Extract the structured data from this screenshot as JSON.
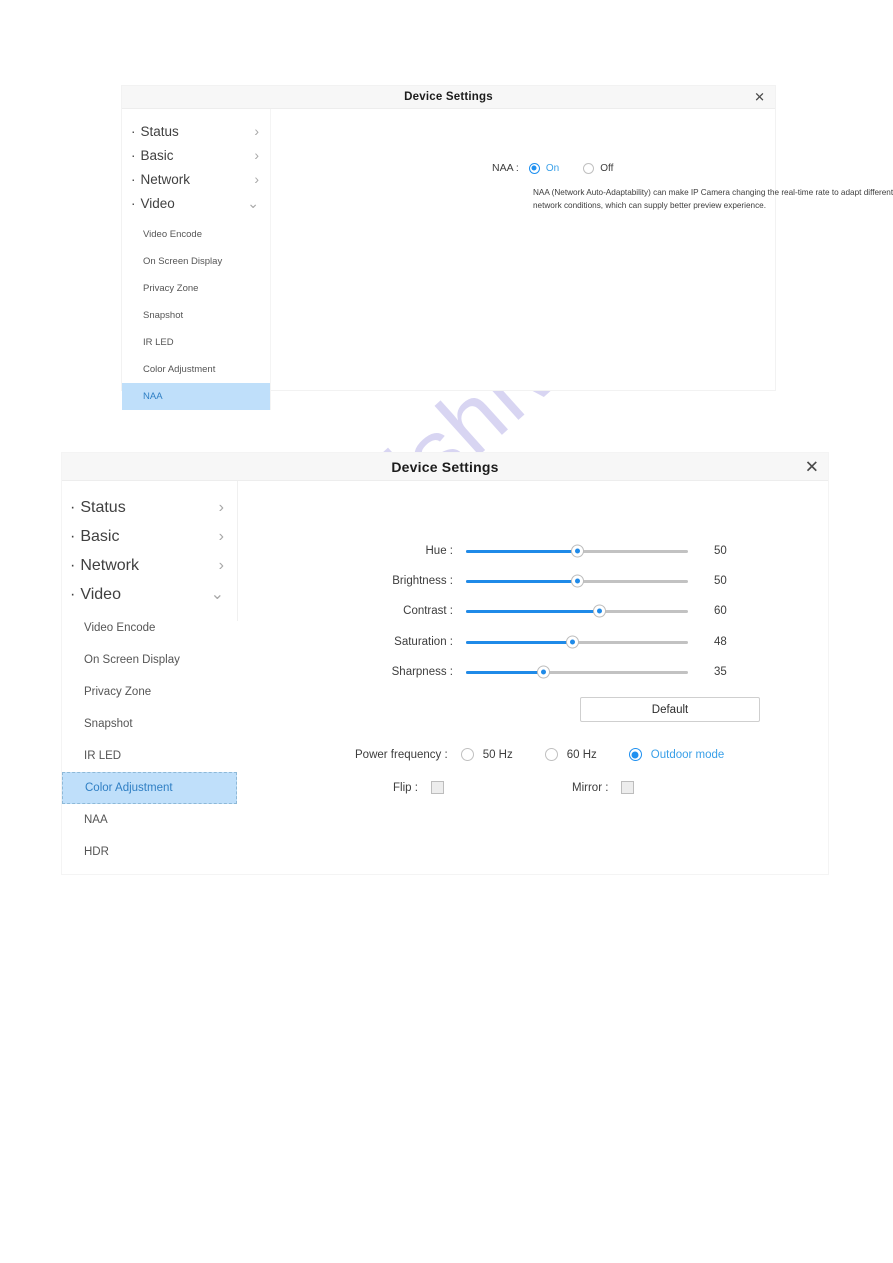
{
  "watermark": {
    "text": "manualshive.com",
    "color": "#b9b4e8"
  },
  "theme": {
    "accent": "#1f8ae8",
    "link": "#3aa0e8",
    "selection_bg": "#bfdffa"
  },
  "dialog_naa": {
    "title": "Device Settings",
    "close_glyph": "✕",
    "sidebar": {
      "top_items": [
        {
          "label": "Status",
          "chevron": "right"
        },
        {
          "label": "Basic",
          "chevron": "right"
        },
        {
          "label": "Network",
          "chevron": "right"
        },
        {
          "label": "Video",
          "chevron": "down"
        }
      ],
      "sub_items": [
        {
          "label": "Video Encode",
          "selected": false
        },
        {
          "label": "On Screen Display",
          "selected": false
        },
        {
          "label": "Privacy Zone",
          "selected": false
        },
        {
          "label": "Snapshot",
          "selected": false
        },
        {
          "label": "IR LED",
          "selected": false
        },
        {
          "label": "Color Adjustment",
          "selected": false
        },
        {
          "label": "NAA",
          "selected": true
        }
      ]
    },
    "content": {
      "field_label": "NAA :",
      "options": [
        {
          "label": "On",
          "checked": true
        },
        {
          "label": "Off",
          "checked": false
        }
      ],
      "description": "NAA (Network Auto-Adaptability) can make IP Camera changing the real-time rate to adapt different network conditions, which can supply better preview experience."
    }
  },
  "dialog_color": {
    "title": "Device Settings",
    "close_glyph": "✕",
    "sidebar": {
      "top_items": [
        {
          "label": "Status",
          "chevron": "right"
        },
        {
          "label": "Basic",
          "chevron": "right"
        },
        {
          "label": "Network",
          "chevron": "right"
        },
        {
          "label": "Video",
          "chevron": "down"
        }
      ],
      "sub_items": [
        {
          "label": "Video Encode",
          "selected": false
        },
        {
          "label": "On Screen Display",
          "selected": false
        },
        {
          "label": "Privacy Zone",
          "selected": false
        },
        {
          "label": "Snapshot",
          "selected": false
        },
        {
          "label": "IR LED",
          "selected": false
        },
        {
          "label": "Color Adjustment",
          "selected": true
        },
        {
          "label": "NAA",
          "selected": false
        },
        {
          "label": "HDR",
          "selected": false
        }
      ]
    },
    "content": {
      "sliders": [
        {
          "label": "Hue :",
          "value": "50",
          "percent": 50
        },
        {
          "label": "Brightness :",
          "value": "50",
          "percent": 50
        },
        {
          "label": "Contrast :",
          "value": "60",
          "percent": 60
        },
        {
          "label": "Saturation :",
          "value": "48",
          "percent": 48
        },
        {
          "label": "Sharpness :",
          "value": "35",
          "percent": 35
        }
      ],
      "default_button": "Default",
      "power_frequency": {
        "label": "Power frequency :",
        "options": [
          {
            "label": "50 Hz",
            "checked": false
          },
          {
            "label": "60 Hz",
            "checked": false
          },
          {
            "label": "Outdoor mode",
            "checked": true
          }
        ]
      },
      "flip": {
        "label": "Flip :",
        "checked": false
      },
      "mirror": {
        "label": "Mirror :",
        "checked": false
      }
    }
  }
}
